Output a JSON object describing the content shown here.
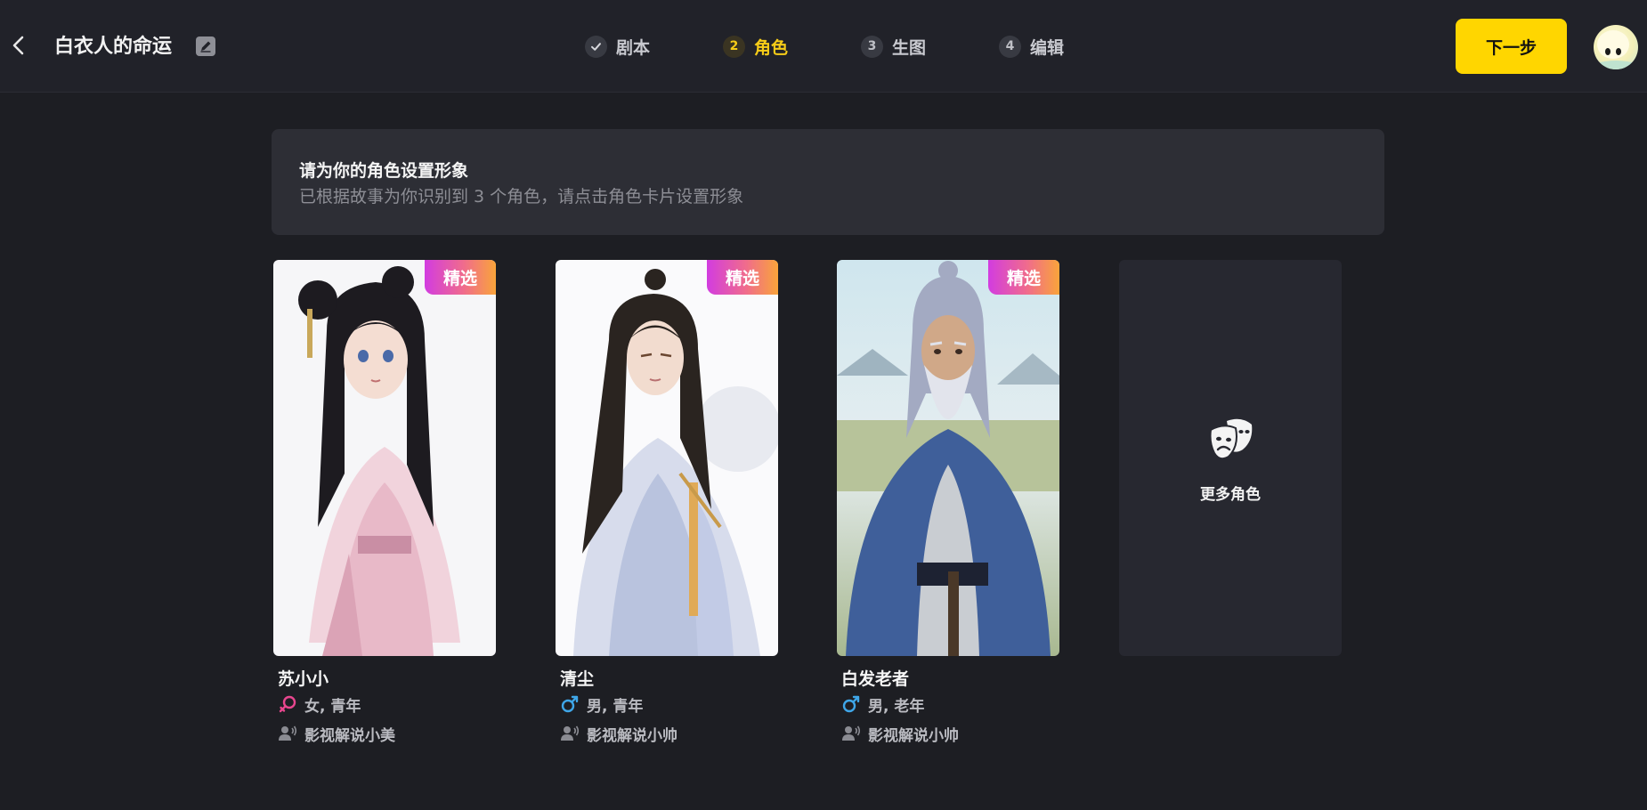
{
  "header": {
    "back_icon": "chevron-left-icon",
    "title": "白衣人的命运",
    "edit_icon": "pencil-icon",
    "steps": [
      {
        "num": "✓",
        "label": "剧本",
        "state": "done"
      },
      {
        "num": "2",
        "label": "角色",
        "state": "active"
      },
      {
        "num": "3",
        "label": "生图",
        "state": "todo"
      },
      {
        "num": "4",
        "label": "编辑",
        "state": "todo"
      }
    ],
    "next_label": "下一步",
    "accent_color": "#ffd600"
  },
  "banner": {
    "title": "请为你的角色设置形象",
    "subtitle": "已根据故事为你识别到 3 个角色，请点击角色卡片设置形象"
  },
  "characters": [
    {
      "badge": "精选",
      "name": "苏小小",
      "gender": "女, 青年",
      "gender_icon": "female-icon",
      "voice": "影视解说小美",
      "voice_icon": "speaker-voice-icon"
    },
    {
      "badge": "精选",
      "name": "清尘",
      "gender": "男, 青年",
      "gender_icon": "male-icon",
      "voice": "影视解说小帅",
      "voice_icon": "speaker-voice-icon"
    },
    {
      "badge": "精选",
      "name": "白发老者",
      "gender": "男, 老年",
      "gender_icon": "male-icon",
      "voice": "影视解说小帅",
      "voice_icon": "speaker-voice-icon"
    }
  ],
  "more_card": {
    "label": "更多角色",
    "icon": "theater-mask-icon"
  },
  "colors": {
    "female": "#e8468e",
    "male": "#3fa6e8",
    "badge_gradient": [
      "#d23ce0",
      "#f9a43a"
    ]
  }
}
